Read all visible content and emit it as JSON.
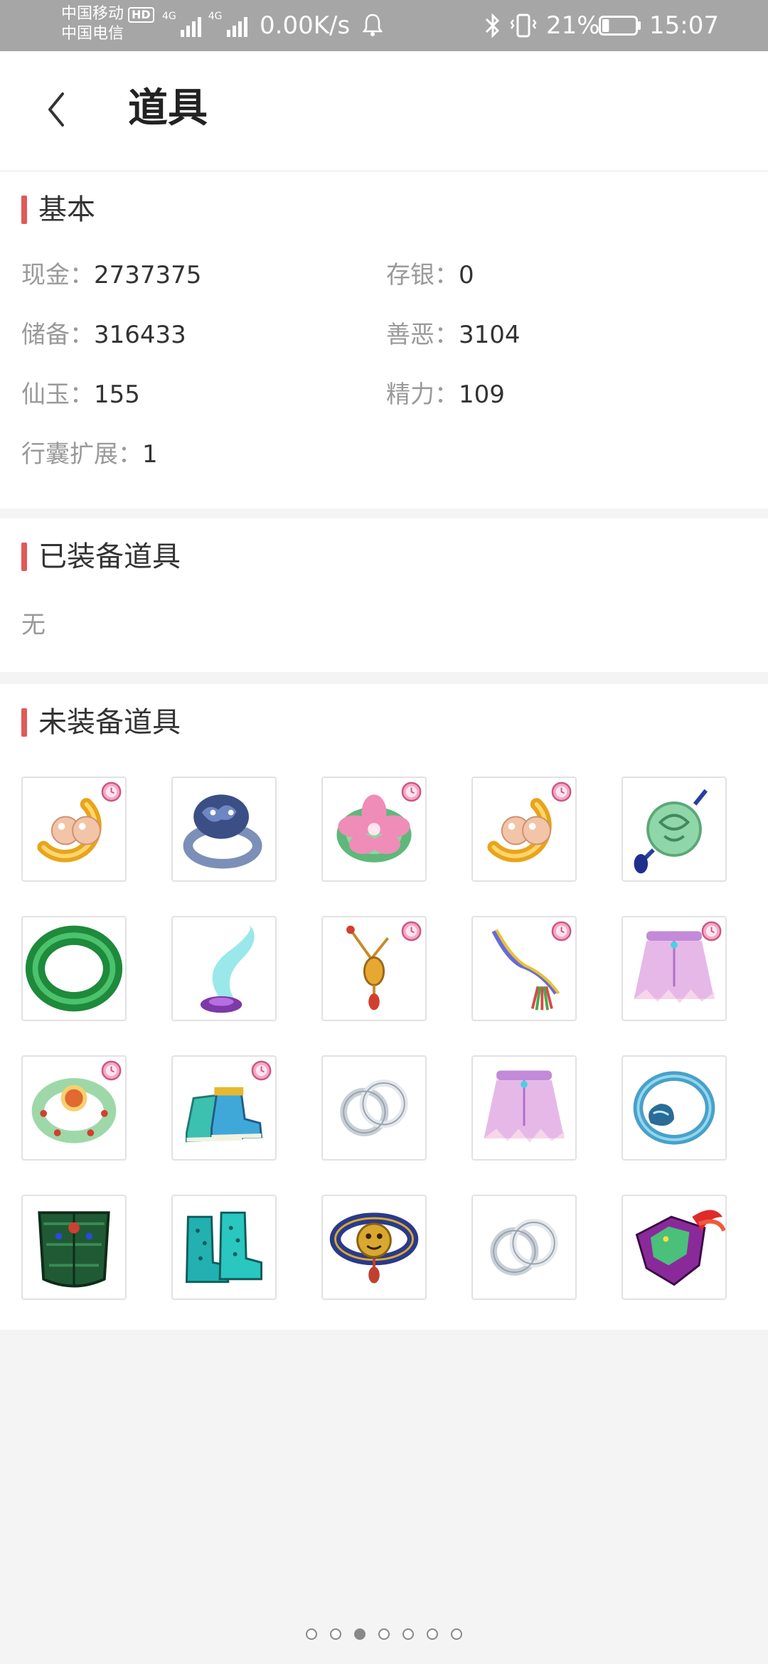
{
  "status": {
    "carrier_1": "中国移动",
    "hd_badge": "HD",
    "carrier_2": "中国电信",
    "net_tag_1": "4G",
    "net_tag_2": "4G",
    "net_speed": "0.00K/s",
    "battery_pct": "21%",
    "battery_level": 0.21,
    "time": "15:07"
  },
  "header": {
    "title": "道具"
  },
  "basic": {
    "title": "基本",
    "fields": [
      {
        "label": "现金：",
        "value": "2737375"
      },
      {
        "label": "存银：",
        "value": "0"
      },
      {
        "label": "储备：",
        "value": "316433"
      },
      {
        "label": "善恶：",
        "value": "3104"
      },
      {
        "label": "仙玉：",
        "value": "155"
      },
      {
        "label": "精力：",
        "value": "109"
      },
      {
        "label": "行囊扩展：",
        "value": "1"
      }
    ]
  },
  "equipped": {
    "title": "已装备道具",
    "empty_text": "无"
  },
  "unequipped": {
    "title": "未装备道具",
    "items": [
      {
        "icon": "gold-pearl-earring-icon",
        "timed": true
      },
      {
        "icon": "blue-dragon-ring-icon",
        "timed": false
      },
      {
        "icon": "jade-flower-ring-icon",
        "timed": true
      },
      {
        "icon": "gold-pearl-earring-icon",
        "timed": true
      },
      {
        "icon": "jade-pendant-icon",
        "timed": false
      },
      {
        "icon": "jade-bracelet-icon",
        "timed": false
      },
      {
        "icon": "magic-lamp-icon",
        "timed": false
      },
      {
        "icon": "gold-pendant-necklace-icon",
        "timed": true
      },
      {
        "icon": "rainbow-cord-icon",
        "timed": true
      },
      {
        "icon": "pink-skirt-icon",
        "timed": true
      },
      {
        "icon": "jade-bangle-icon",
        "timed": true
      },
      {
        "icon": "teal-sneakers-icon",
        "timed": true
      },
      {
        "icon": "silver-double-ring-icon",
        "timed": false
      },
      {
        "icon": "pink-skirt-icon",
        "timed": false
      },
      {
        "icon": "blue-dragon-bracelet-icon",
        "timed": false
      },
      {
        "icon": "green-armor-icon",
        "timed": false
      },
      {
        "icon": "teal-boots-icon",
        "timed": false
      },
      {
        "icon": "lion-head-belt-icon",
        "timed": false
      },
      {
        "icon": "silver-double-ring-icon",
        "timed": false
      },
      {
        "icon": "purple-dragon-helmet-icon",
        "timed": false
      }
    ]
  },
  "pager": {
    "count": 7,
    "active": 2
  }
}
